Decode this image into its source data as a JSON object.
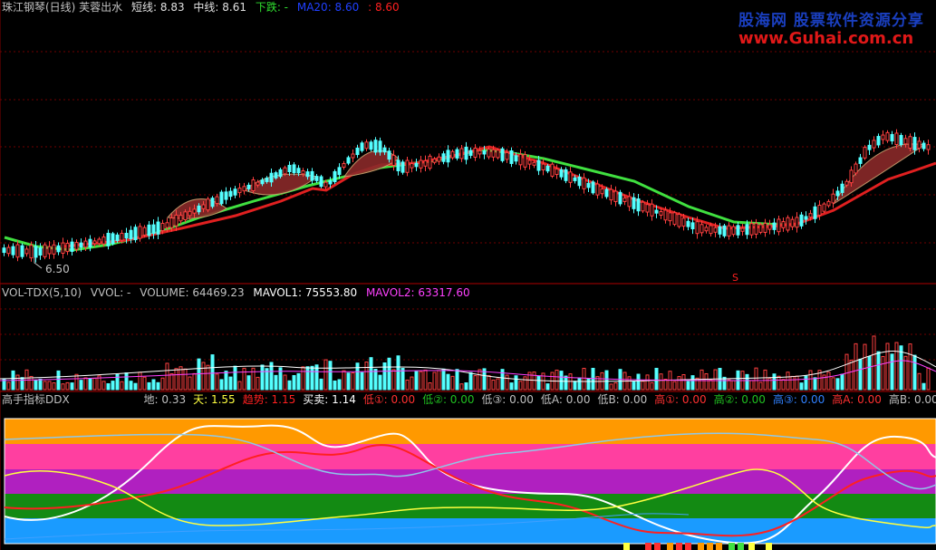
{
  "main_panel": {
    "title": "珠江钢琴(日线) 芙蓉出水",
    "short_line": "短线: 8.83",
    "mid_line": "中线: 8.61",
    "down": "下跌: -",
    "ma20": "MA20: 8.60",
    "value2": ": 8.60",
    "low_marker": "6.50",
    "s_marker": "S"
  },
  "volume_panel": {
    "title": "VOL-TDX(5,10)",
    "vvol": "VVOL: -",
    "volume": "VOLUME: 64469.23",
    "mavol1": "MAVOL1: 75553.80",
    "mavol2": "MAVOL2: 63317.60"
  },
  "ddx_panel": {
    "title": "高手指标DDX",
    "values": [
      {
        "label": "地: 0.33",
        "color": "#c0c0c0"
      },
      {
        "label": "天: 1.55",
        "color": "#ffff40"
      },
      {
        "label": "趋势: 1.15",
        "color": "#ff2020"
      },
      {
        "label": "买卖: 1.14",
        "color": "#ffffff"
      },
      {
        "label": "低①: 0.00",
        "color": "#ff3030"
      },
      {
        "label": "低②: 0.00",
        "color": "#20c020"
      },
      {
        "label": "低③: 0.00",
        "color": "#c0c0c0"
      },
      {
        "label": "低A: 0.00",
        "color": "#c0c0c0"
      },
      {
        "label": "低B: 0.00",
        "color": "#c0c0c0"
      },
      {
        "label": "高①: 0.00",
        "color": "#ff3030"
      },
      {
        "label": "高②: 0.00",
        "color": "#20c020"
      },
      {
        "label": "高③: 0.00",
        "color": "#3080ff"
      },
      {
        "label": "高A: 0.00",
        "color": "#ff3030"
      },
      {
        "label": "高B: 0.00",
        "color": "#c0c0c0"
      }
    ]
  },
  "logo": {
    "line1": "股海网 股票软件资源分享",
    "line2": "www.Guhai.com.cn"
  },
  "colors": {
    "up": "#ff4040",
    "down": "#54ffff",
    "ma_short": "#e02020",
    "ma_green": "#40e040",
    "band_orange": "#ff9900",
    "band_pink": "#ff3fa0",
    "band_purple": "#b020c0",
    "band_green": "#138a13",
    "band_blue": "#1a9bff"
  }
}
